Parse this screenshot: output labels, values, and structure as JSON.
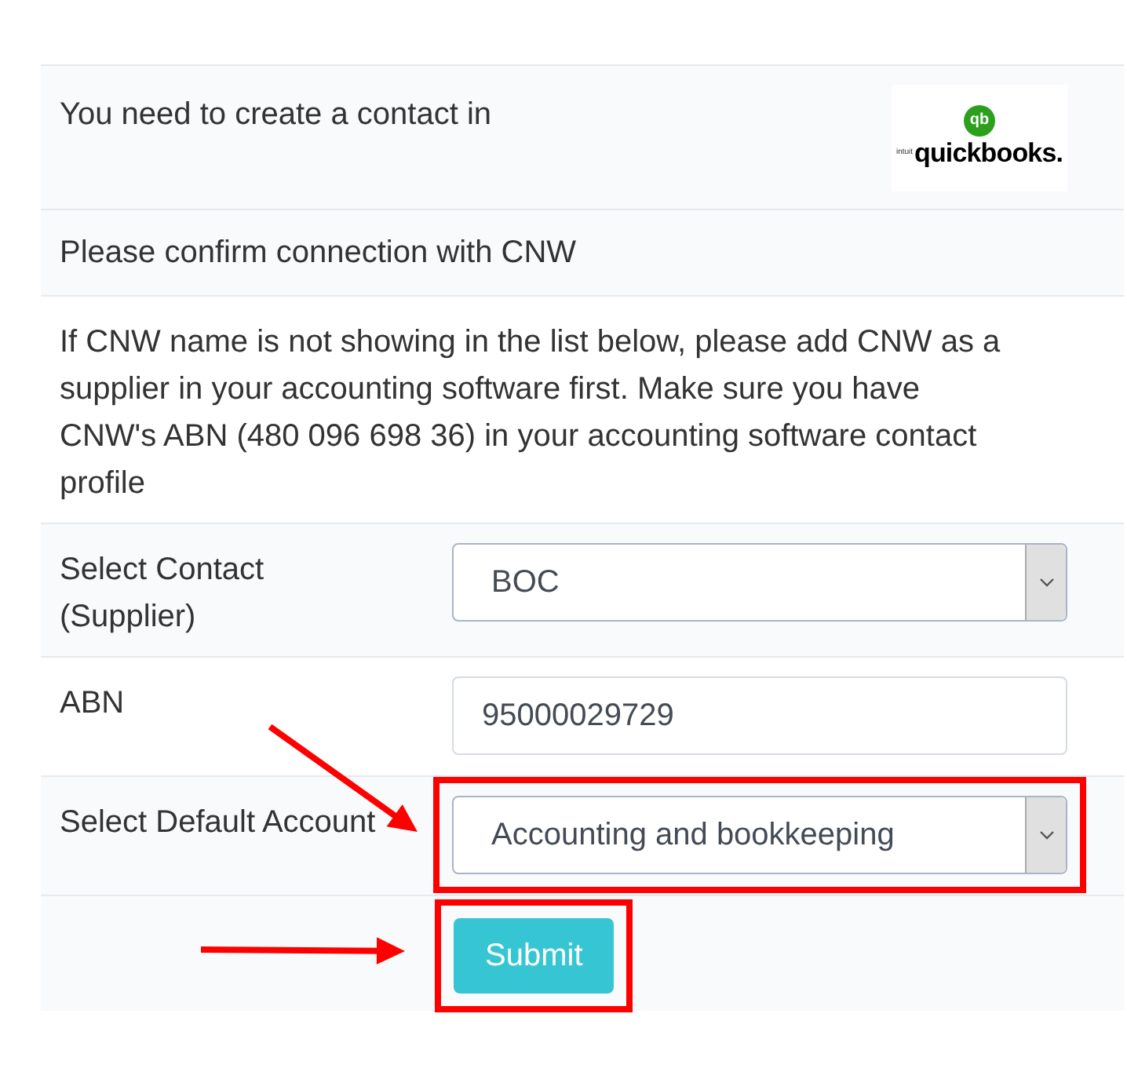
{
  "intro": {
    "text": "You need to create a contact in",
    "logo": {
      "mark": "qb",
      "small": "intuit",
      "name": "quickbooks."
    }
  },
  "confirm": "Please confirm connection with CNW",
  "note": "If CNW name is not showing in the list below, please add CNW as a supplier in your accounting software first. Make sure you have CNW's ABN (480 096 698 36) in your accounting software contact profile",
  "fields": [
    {
      "label": "Select Contact (Supplier)",
      "kind": "select",
      "value": "BOC",
      "highlighted": false
    },
    {
      "label": "ABN",
      "kind": "input",
      "value": "95000029729",
      "highlighted": false
    },
    {
      "label": "Select Default Account",
      "kind": "select",
      "value": "Accounting and bookkeeping",
      "highlighted": true
    }
  ],
  "submit": {
    "label": "Submit",
    "highlighted": true
  }
}
